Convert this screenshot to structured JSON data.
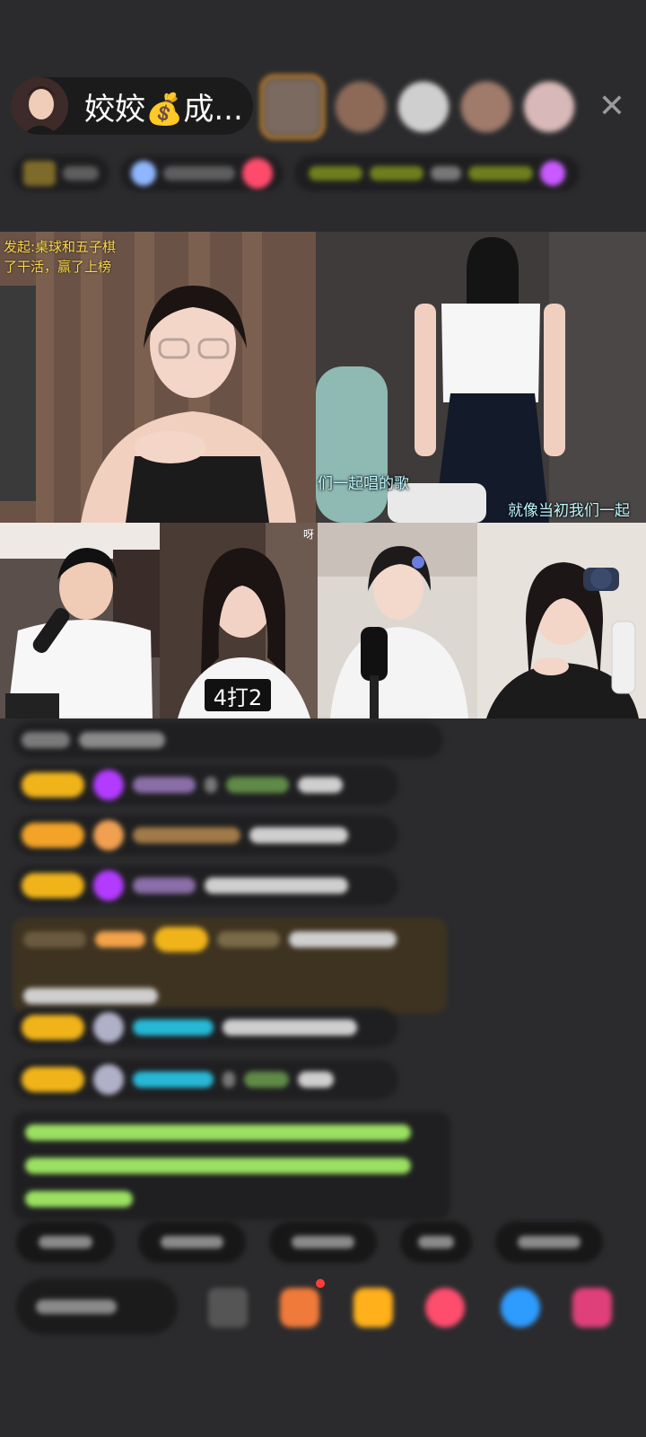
{
  "host": {
    "name": "姣姣💰成...",
    "avatar_icon": "host-avatar"
  },
  "audience": {
    "count": 5,
    "close_icon": "close-icon"
  },
  "grid": {
    "cell1_caption_line1": "发起:桌球和五子棋",
    "cell1_caption_line2": "了干活，赢了上榜",
    "cell2_subtitle_a": "们一起唱的歌",
    "cell2_subtitle_b": "就像当初我们一起",
    "cell4_corner_text": "呀",
    "badge": "4打2"
  },
  "colors": {
    "background": "#2b2b2d",
    "level_badge": "#f0b41a",
    "highlight_message_bg": "#3e3320",
    "accent_green": "#9be062",
    "accent_cyan": "#27b8d6",
    "accent_purple": "#b23bff"
  }
}
